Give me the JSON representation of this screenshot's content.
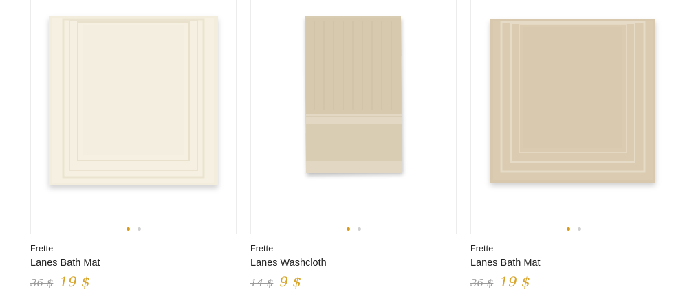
{
  "colors": {
    "accent": "#d8a52c",
    "dot_active": "#d89a1e",
    "dot_inactive": "#cfcfcf",
    "old_price": "#9a9a9a",
    "text": "#222222"
  },
  "products": [
    {
      "brand": "Frette",
      "name": "Lanes Bath Mat",
      "old_price": "36 $",
      "new_price": "19 $",
      "image": "ivory-bath-mat-image",
      "image_color": "#f2ecdc",
      "carousel": {
        "count": 2,
        "active": 0
      }
    },
    {
      "brand": "Frette",
      "name": "Lanes Washcloth",
      "old_price": "14 $",
      "new_price": "9 $",
      "image": "beige-washcloth-image",
      "image_color": "#d9cdb4",
      "carousel": {
        "count": 2,
        "active": 0
      }
    },
    {
      "brand": "Frette",
      "name": "Lanes Bath Mat",
      "old_price": "36 $",
      "new_price": "19 $",
      "image": "sand-bath-mat-image",
      "image_color": "#dccdb4",
      "carousel": {
        "count": 2,
        "active": 0
      }
    }
  ]
}
